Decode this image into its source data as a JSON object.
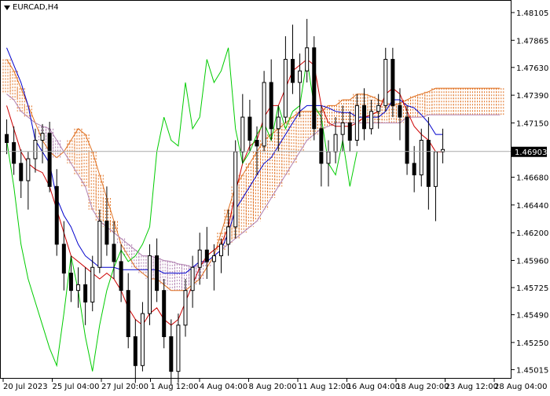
{
  "window": {
    "symbol_title": "EURCAD,H4",
    "dropdown_icon": "triangle-down-icon"
  },
  "price_axis": {
    "current_price": "1.46903",
    "current_price_value": 1.46903
  },
  "colors": {
    "candle": "#000000",
    "tenkan": "#cc0000",
    "kijun": "#0000cc",
    "chikou": "#00cc00",
    "senkou_a": "#e07020",
    "senkou_b": "#b080b0",
    "grid_line": "#999999"
  },
  "chart_data": {
    "type": "candlestick",
    "title": "EURCAD,H4",
    "indicator": "Ichimoku Kinko Hyo",
    "ylim": [
      1.4495,
      1.482
    ],
    "y_ticks": [
      "1.48105",
      "1.47865",
      "1.47630",
      "1.47390",
      "1.47150",
      "1.46903",
      "1.46680",
      "1.46440",
      "1.46200",
      "1.45960",
      "1.45725",
      "1.45490",
      "1.45250",
      "1.45015"
    ],
    "x_ticks": [
      "20 Jul 2023",
      "25 Jul 04:00",
      "27 Jul 20:00",
      "1 Aug 12:00",
      "4 Aug 04:00",
      "8 Aug 20:00",
      "11 Aug 12:00",
      "16 Aug 04:00",
      "18 Aug 20:00",
      "23 Aug 12:00",
      "28 Aug 04:00"
    ],
    "candles": [
      [
        1.4705,
        1.4718,
        1.4688,
        1.4698
      ],
      [
        1.4698,
        1.4712,
        1.467,
        1.468
      ],
      [
        1.468,
        1.4692,
        1.465,
        1.4665
      ],
      [
        1.4665,
        1.469,
        1.464,
        1.4684
      ],
      [
        1.4684,
        1.471,
        1.4672,
        1.47
      ],
      [
        1.47,
        1.4714,
        1.468,
        1.4706
      ],
      [
        1.4706,
        1.4716,
        1.4655,
        1.466
      ],
      [
        1.466,
        1.4675,
        1.46,
        1.461
      ],
      [
        1.461,
        1.463,
        1.457,
        1.4585
      ],
      [
        1.4585,
        1.46,
        1.456,
        1.457
      ],
      [
        1.457,
        1.459,
        1.4555,
        1.4575
      ],
      [
        1.4575,
        1.459,
        1.454,
        1.456
      ],
      [
        1.456,
        1.46,
        1.4552,
        1.459
      ],
      [
        1.459,
        1.464,
        1.4585,
        1.463
      ],
      [
        1.463,
        1.466,
        1.46,
        1.461
      ],
      [
        1.461,
        1.463,
        1.458,
        1.4595
      ],
      [
        1.4595,
        1.461,
        1.456,
        1.457
      ],
      [
        1.457,
        1.4585,
        1.452,
        1.453
      ],
      [
        1.453,
        1.4545,
        1.449,
        1.4505
      ],
      [
        1.4505,
        1.456,
        1.45,
        1.455
      ],
      [
        1.455,
        1.461,
        1.454,
        1.46
      ],
      [
        1.46,
        1.4615,
        1.456,
        1.457
      ],
      [
        1.457,
        1.458,
        1.452,
        1.453
      ],
      [
        1.453,
        1.4545,
        1.4488,
        1.45
      ],
      [
        1.45,
        1.455,
        1.449,
        1.454
      ],
      [
        1.454,
        1.458,
        1.453,
        1.457
      ],
      [
        1.457,
        1.46,
        1.4555,
        1.459
      ],
      [
        1.459,
        1.462,
        1.4575,
        1.4605
      ],
      [
        1.4605,
        1.4625,
        1.458,
        1.4595
      ],
      [
        1.4595,
        1.461,
        1.457,
        1.46
      ],
      [
        1.46,
        1.4615,
        1.4585,
        1.461
      ],
      [
        1.461,
        1.464,
        1.46,
        1.4625
      ],
      [
        1.4625,
        1.47,
        1.4615,
        1.469
      ],
      [
        1.469,
        1.474,
        1.468,
        1.472
      ],
      [
        1.472,
        1.4735,
        1.469,
        1.47
      ],
      [
        1.47,
        1.4712,
        1.467,
        1.4695
      ],
      [
        1.4695,
        1.476,
        1.469,
        1.475
      ],
      [
        1.475,
        1.477,
        1.47,
        1.471
      ],
      [
        1.471,
        1.473,
        1.469,
        1.472
      ],
      [
        1.472,
        1.479,
        1.4715,
        1.477
      ],
      [
        1.477,
        1.48,
        1.474,
        1.475
      ],
      [
        1.475,
        1.4775,
        1.472,
        1.476
      ],
      [
        1.476,
        1.4805,
        1.475,
        1.478
      ],
      [
        1.478,
        1.479,
        1.47,
        1.471
      ],
      [
        1.471,
        1.473,
        1.466,
        1.468
      ],
      [
        1.468,
        1.47,
        1.466,
        1.469
      ],
      [
        1.469,
        1.472,
        1.468,
        1.4705
      ],
      [
        1.4705,
        1.473,
        1.469,
        1.4715
      ],
      [
        1.4715,
        1.4725,
        1.469,
        1.47
      ],
      [
        1.47,
        1.474,
        1.4695,
        1.473
      ],
      [
        1.473,
        1.4745,
        1.47,
        1.471
      ],
      [
        1.471,
        1.4735,
        1.4705,
        1.4725
      ],
      [
        1.4725,
        1.474,
        1.471,
        1.473
      ],
      [
        1.473,
        1.478,
        1.4725,
        1.477
      ],
      [
        1.477,
        1.478,
        1.472,
        1.473
      ],
      [
        1.473,
        1.4745,
        1.47,
        1.472
      ],
      [
        1.472,
        1.473,
        1.467,
        1.468
      ],
      [
        1.468,
        1.4695,
        1.4655,
        1.467
      ],
      [
        1.467,
        1.471,
        1.466,
        1.47
      ],
      [
        1.47,
        1.472,
        1.464,
        1.466
      ],
      [
        1.466,
        1.469,
        1.463,
        1.469
      ],
      [
        1.469,
        1.471,
        1.468,
        1.4692
      ]
    ],
    "tenkan_sen": [
      1.473,
      1.471,
      1.469,
      1.468,
      1.4675,
      1.4672,
      1.466,
      1.464,
      1.462,
      1.46,
      1.4595,
      1.459,
      1.4585,
      1.458,
      1.4585,
      1.458,
      1.457,
      1.4555,
      1.4545,
      1.454,
      1.455,
      1.4555,
      1.4545,
      1.454,
      1.4545,
      1.456,
      1.4575,
      1.459,
      1.46,
      1.4605,
      1.461,
      1.4625,
      1.4655,
      1.468,
      1.4695,
      1.47,
      1.472,
      1.473,
      1.473,
      1.4745,
      1.476,
      1.4765,
      1.477,
      1.4765,
      1.473,
      1.4715,
      1.4712,
      1.4712,
      1.4712,
      1.4715,
      1.472,
      1.4722,
      1.4725,
      1.474,
      1.4745,
      1.474,
      1.4725,
      1.4712,
      1.4705,
      1.47,
      1.469,
      1.469
    ],
    "kijun_sen": [
      1.478,
      1.4765,
      1.475,
      1.473,
      1.47,
      1.469,
      1.468,
      1.465,
      1.4635,
      1.4625,
      1.461,
      1.46,
      1.4595,
      1.459,
      1.459,
      1.459,
      1.4588,
      1.4588,
      1.4588,
      1.4588,
      1.4588,
      1.4588,
      1.4585,
      1.4585,
      1.4585,
      1.4585,
      1.459,
      1.4595,
      1.4595,
      1.46,
      1.4605,
      1.462,
      1.464,
      1.465,
      1.466,
      1.467,
      1.468,
      1.4685,
      1.4695,
      1.4705,
      1.4715,
      1.4725,
      1.473,
      1.473,
      1.473,
      1.4728,
      1.4725,
      1.4724,
      1.4724,
      1.472,
      1.472,
      1.472,
      1.472,
      1.4725,
      1.4735,
      1.4735,
      1.473,
      1.4728,
      1.4722,
      1.4715,
      1.4705,
      1.4705
    ],
    "chikou_span": [
      1.47,
      1.466,
      1.461,
      1.458,
      1.456,
      1.454,
      1.452,
      1.4505,
      1.455,
      1.46,
      1.457,
      1.453,
      1.45,
      1.454,
      1.457,
      1.459,
      1.4605,
      1.4595,
      1.46,
      1.461,
      1.4625,
      1.469,
      1.472,
      1.47,
      1.4695,
      1.475,
      1.471,
      1.472,
      1.477,
      1.475,
      1.476,
      1.478,
      1.471,
      1.468,
      1.469,
      1.4705,
      1.4715,
      1.47,
      1.473,
      1.471,
      1.4725,
      1.473,
      1.477,
      1.473,
      1.472,
      1.468,
      1.467,
      1.47,
      1.466,
      1.469
    ],
    "senkou_span_a": [
      1.477,
      1.476,
      1.4745,
      1.473,
      1.4715,
      1.47,
      1.469,
      1.4685,
      1.469,
      1.47,
      1.471,
      1.4705,
      1.469,
      1.467,
      1.465,
      1.463,
      1.461,
      1.46,
      1.459,
      1.4585,
      1.458,
      1.458,
      1.4575,
      1.457,
      1.457,
      1.457,
      1.4575,
      1.458,
      1.459,
      1.46,
      1.462,
      1.464,
      1.466,
      1.467,
      1.468,
      1.469,
      1.47,
      1.4705,
      1.471,
      1.4715,
      1.472,
      1.4725,
      1.4725,
      1.4725,
      1.4725,
      1.473,
      1.473,
      1.4735,
      1.4735,
      1.474,
      1.474,
      1.4738,
      1.4735,
      1.4732,
      1.473,
      1.4732,
      1.4735,
      1.4738,
      1.474,
      1.4742,
      1.4745,
      1.4745,
      1.4745,
      1.4745,
      1.4745,
      1.4745,
      1.4745,
      1.4745,
      1.4745,
      1.4745
    ],
    "senkou_span_b": [
      1.474,
      1.4735,
      1.4725,
      1.472,
      1.4715,
      1.4712,
      1.471,
      1.47,
      1.469,
      1.468,
      1.467,
      1.466,
      1.464,
      1.463,
      1.4625,
      1.462,
      1.4615,
      1.461,
      1.4605,
      1.46,
      1.46,
      1.4598,
      1.4596,
      1.4595,
      1.4593,
      1.4592,
      1.459,
      1.4592,
      1.4595,
      1.46,
      1.4605,
      1.461,
      1.4615,
      1.462,
      1.4625,
      1.463,
      1.464,
      1.465,
      1.466,
      1.467,
      1.468,
      1.469,
      1.47,
      1.4705,
      1.471,
      1.4712,
      1.4715,
      1.4715,
      1.4715,
      1.4715,
      1.4715,
      1.4715,
      1.4715,
      1.4715,
      1.4715,
      1.4715,
      1.472,
      1.472,
      1.472,
      1.4722,
      1.4722,
      1.4722,
      1.4722,
      1.4722,
      1.4722,
      1.4722,
      1.4722,
      1.4722,
      1.4722,
      1.4722
    ],
    "current_price_line": 1.46903,
    "grid": false
  }
}
